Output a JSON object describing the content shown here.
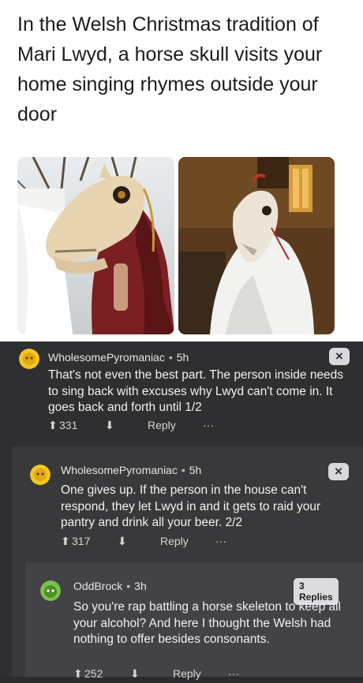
{
  "headline": "In the Welsh Christmas tradition of Mari Lwyd, a horse skull visits your home singing rhymes outside your door",
  "comments": [
    {
      "username": "WholesomePyromaniac",
      "separator": "•",
      "time": "5h",
      "body": "That's not even the best part. The person inside needs to sing back with excuses why Lwyd can't come in. It goes back and forth until 1/2",
      "score": "331",
      "reply_label": "Reply",
      "more_label": "···",
      "close_label": "×"
    },
    {
      "username": "WholesomePyromaniac",
      "separator": "•",
      "time": "5h",
      "body": "One gives up. If the person in the house can't respond, they let Lwyd in and it gets to raid your pantry and drink all your beer. 2/2",
      "score": "317",
      "reply_label": "Reply",
      "more_label": "···",
      "close_label": "×"
    },
    {
      "username": "OddBrock",
      "separator": "•",
      "time": "3h",
      "body": "So you're rap battling a horse skeleton to keep all your alcohol? And here I thought the Welsh had nothing to offer besides consonants.",
      "score": "252",
      "reply_label": "Reply",
      "more_label": "···",
      "replies_label": "3 Replies"
    }
  ],
  "colors": {
    "background_top": "#ffffff",
    "comment_bg": "#2f2f31",
    "avatar_yellow": "#f3c623",
    "avatar_green": "#7cc24c"
  }
}
